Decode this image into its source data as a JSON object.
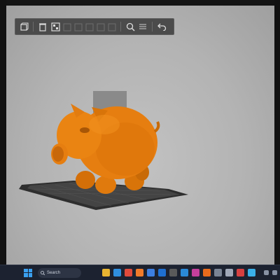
{
  "toolbar": {
    "buttons": [
      {
        "name": "cube-view-icon"
      },
      {
        "name": "delete-icon"
      },
      {
        "name": "arrange-icon"
      },
      {
        "name": "zoom-icon"
      },
      {
        "name": "layers-icon"
      },
      {
        "name": "undo-icon"
      }
    ]
  },
  "taskbar": {
    "search_label": "Search",
    "apps": [
      {
        "name": "files-app",
        "color": "#e8b431"
      },
      {
        "name": "edge-app",
        "color": "#2f8fe0"
      },
      {
        "name": "chrome-app",
        "color": "#e04a3b"
      },
      {
        "name": "firefox-app",
        "color": "#f07b2a"
      },
      {
        "name": "store-app",
        "color": "#3d7fe0"
      },
      {
        "name": "mail-app",
        "color": "#1f6fd0"
      },
      {
        "name": "terminal-app",
        "color": "#5a5a5a"
      },
      {
        "name": "vscode-app",
        "color": "#2a8ad8"
      },
      {
        "name": "photos-app",
        "color": "#c43f9c"
      },
      {
        "name": "slicer-app",
        "color": "#e86b1c"
      },
      {
        "name": "settings-app",
        "color": "#7a8494"
      },
      {
        "name": "clock-app",
        "color": "#a0a8b8"
      },
      {
        "name": "music-app",
        "color": "#d64040"
      },
      {
        "name": "cloud-app",
        "color": "#3ab0e8"
      }
    ]
  },
  "colors": {
    "model": "#e67e10",
    "model_shadow": "#a85606",
    "bed": "#3a3a3a",
    "accent": "#3aa0f0"
  }
}
